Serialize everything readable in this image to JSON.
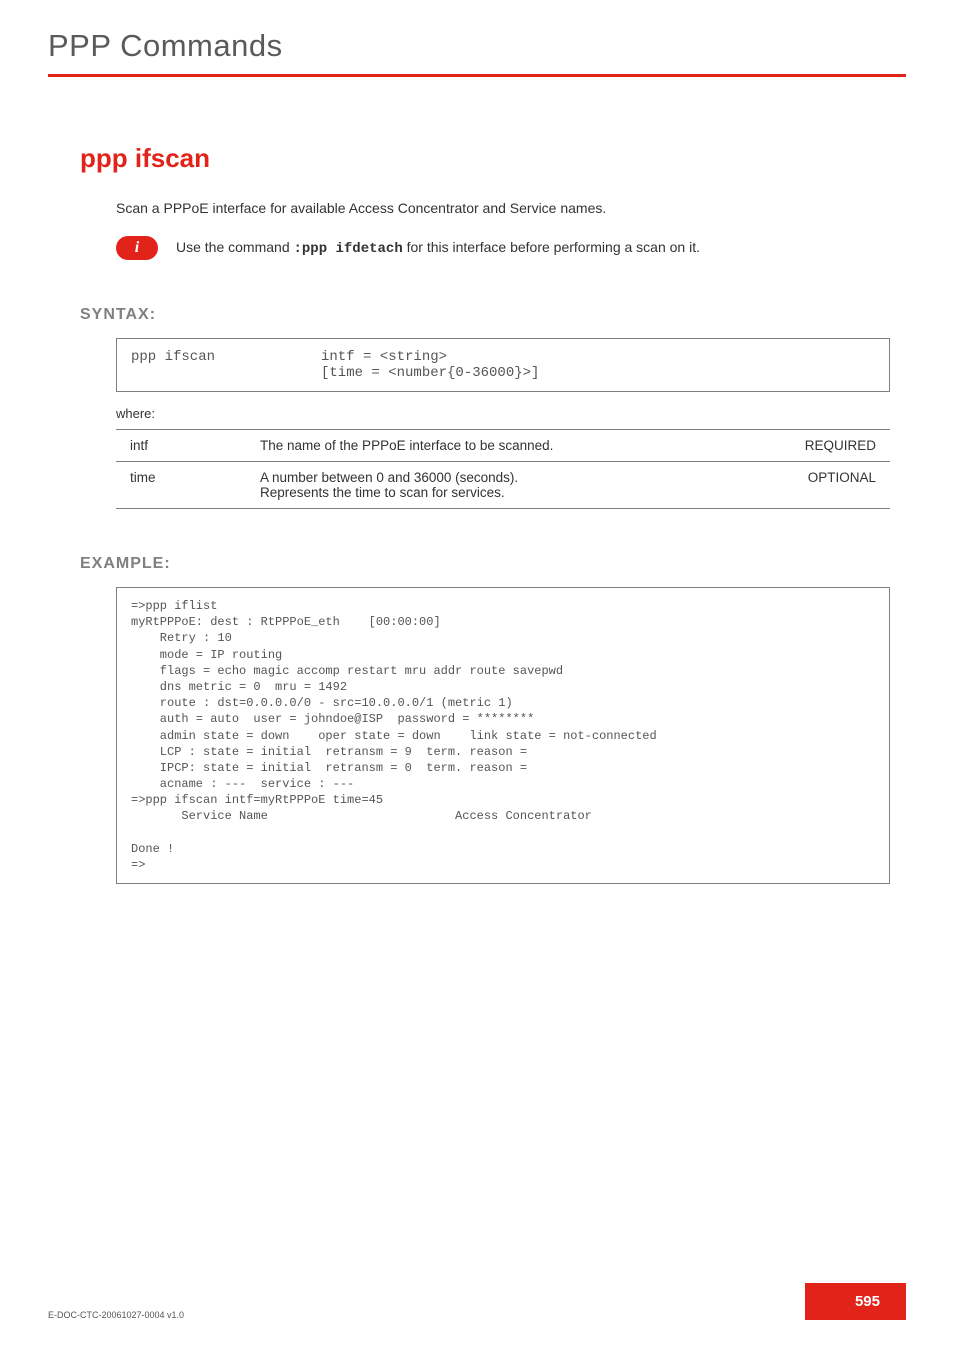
{
  "header": {
    "chapter_title": "PPP Commands"
  },
  "command": {
    "title": "ppp ifscan",
    "description": "Scan a PPPoE interface for available Access Concentrator and Service names."
  },
  "note": {
    "prefix": "Use the command ",
    "cmd": ":ppp ifdetach",
    "suffix": " for this interface before performing a scan on it.",
    "icon_glyph": "i"
  },
  "syntax": {
    "heading": "SYNTAX:",
    "cmd": "ppp ifscan",
    "args": "intf = <string>\n[time = <number{0-36000}>]",
    "where_label": "where:",
    "params": [
      {
        "name": "intf",
        "desc": "The name of the PPPoE interface to be scanned.",
        "req": "REQUIRED"
      },
      {
        "name": "time",
        "desc": "A number between 0 and 36000 (seconds).\nRepresents the time to scan for services.",
        "req": "OPTIONAL"
      }
    ]
  },
  "example": {
    "heading": "EXAMPLE:",
    "body": "=>ppp iflist\nmyRtPPPoE: dest : RtPPPoE_eth    [00:00:00]\n    Retry : 10\n    mode = IP routing\n    flags = echo magic accomp restart mru addr route savepwd\n    dns metric = 0  mru = 1492\n    route : dst=0.0.0.0/0 - src=10.0.0.0/1 (metric 1)\n    auth = auto  user = johndoe@ISP  password = ********\n    admin state = down    oper state = down    link state = not-connected\n    LCP : state = initial  retransm = 9  term. reason =\n    IPCP: state = initial  retransm = 0  term. reason =\n    acname : ---  service : ---\n=>ppp ifscan intf=myRtPPPoE time=45\n       Service Name                          Access Concentrator\n\nDone !\n=>"
  },
  "footer": {
    "doc_id": "E-DOC-CTC-20061027-0004 v1.0",
    "page_number": "595"
  }
}
